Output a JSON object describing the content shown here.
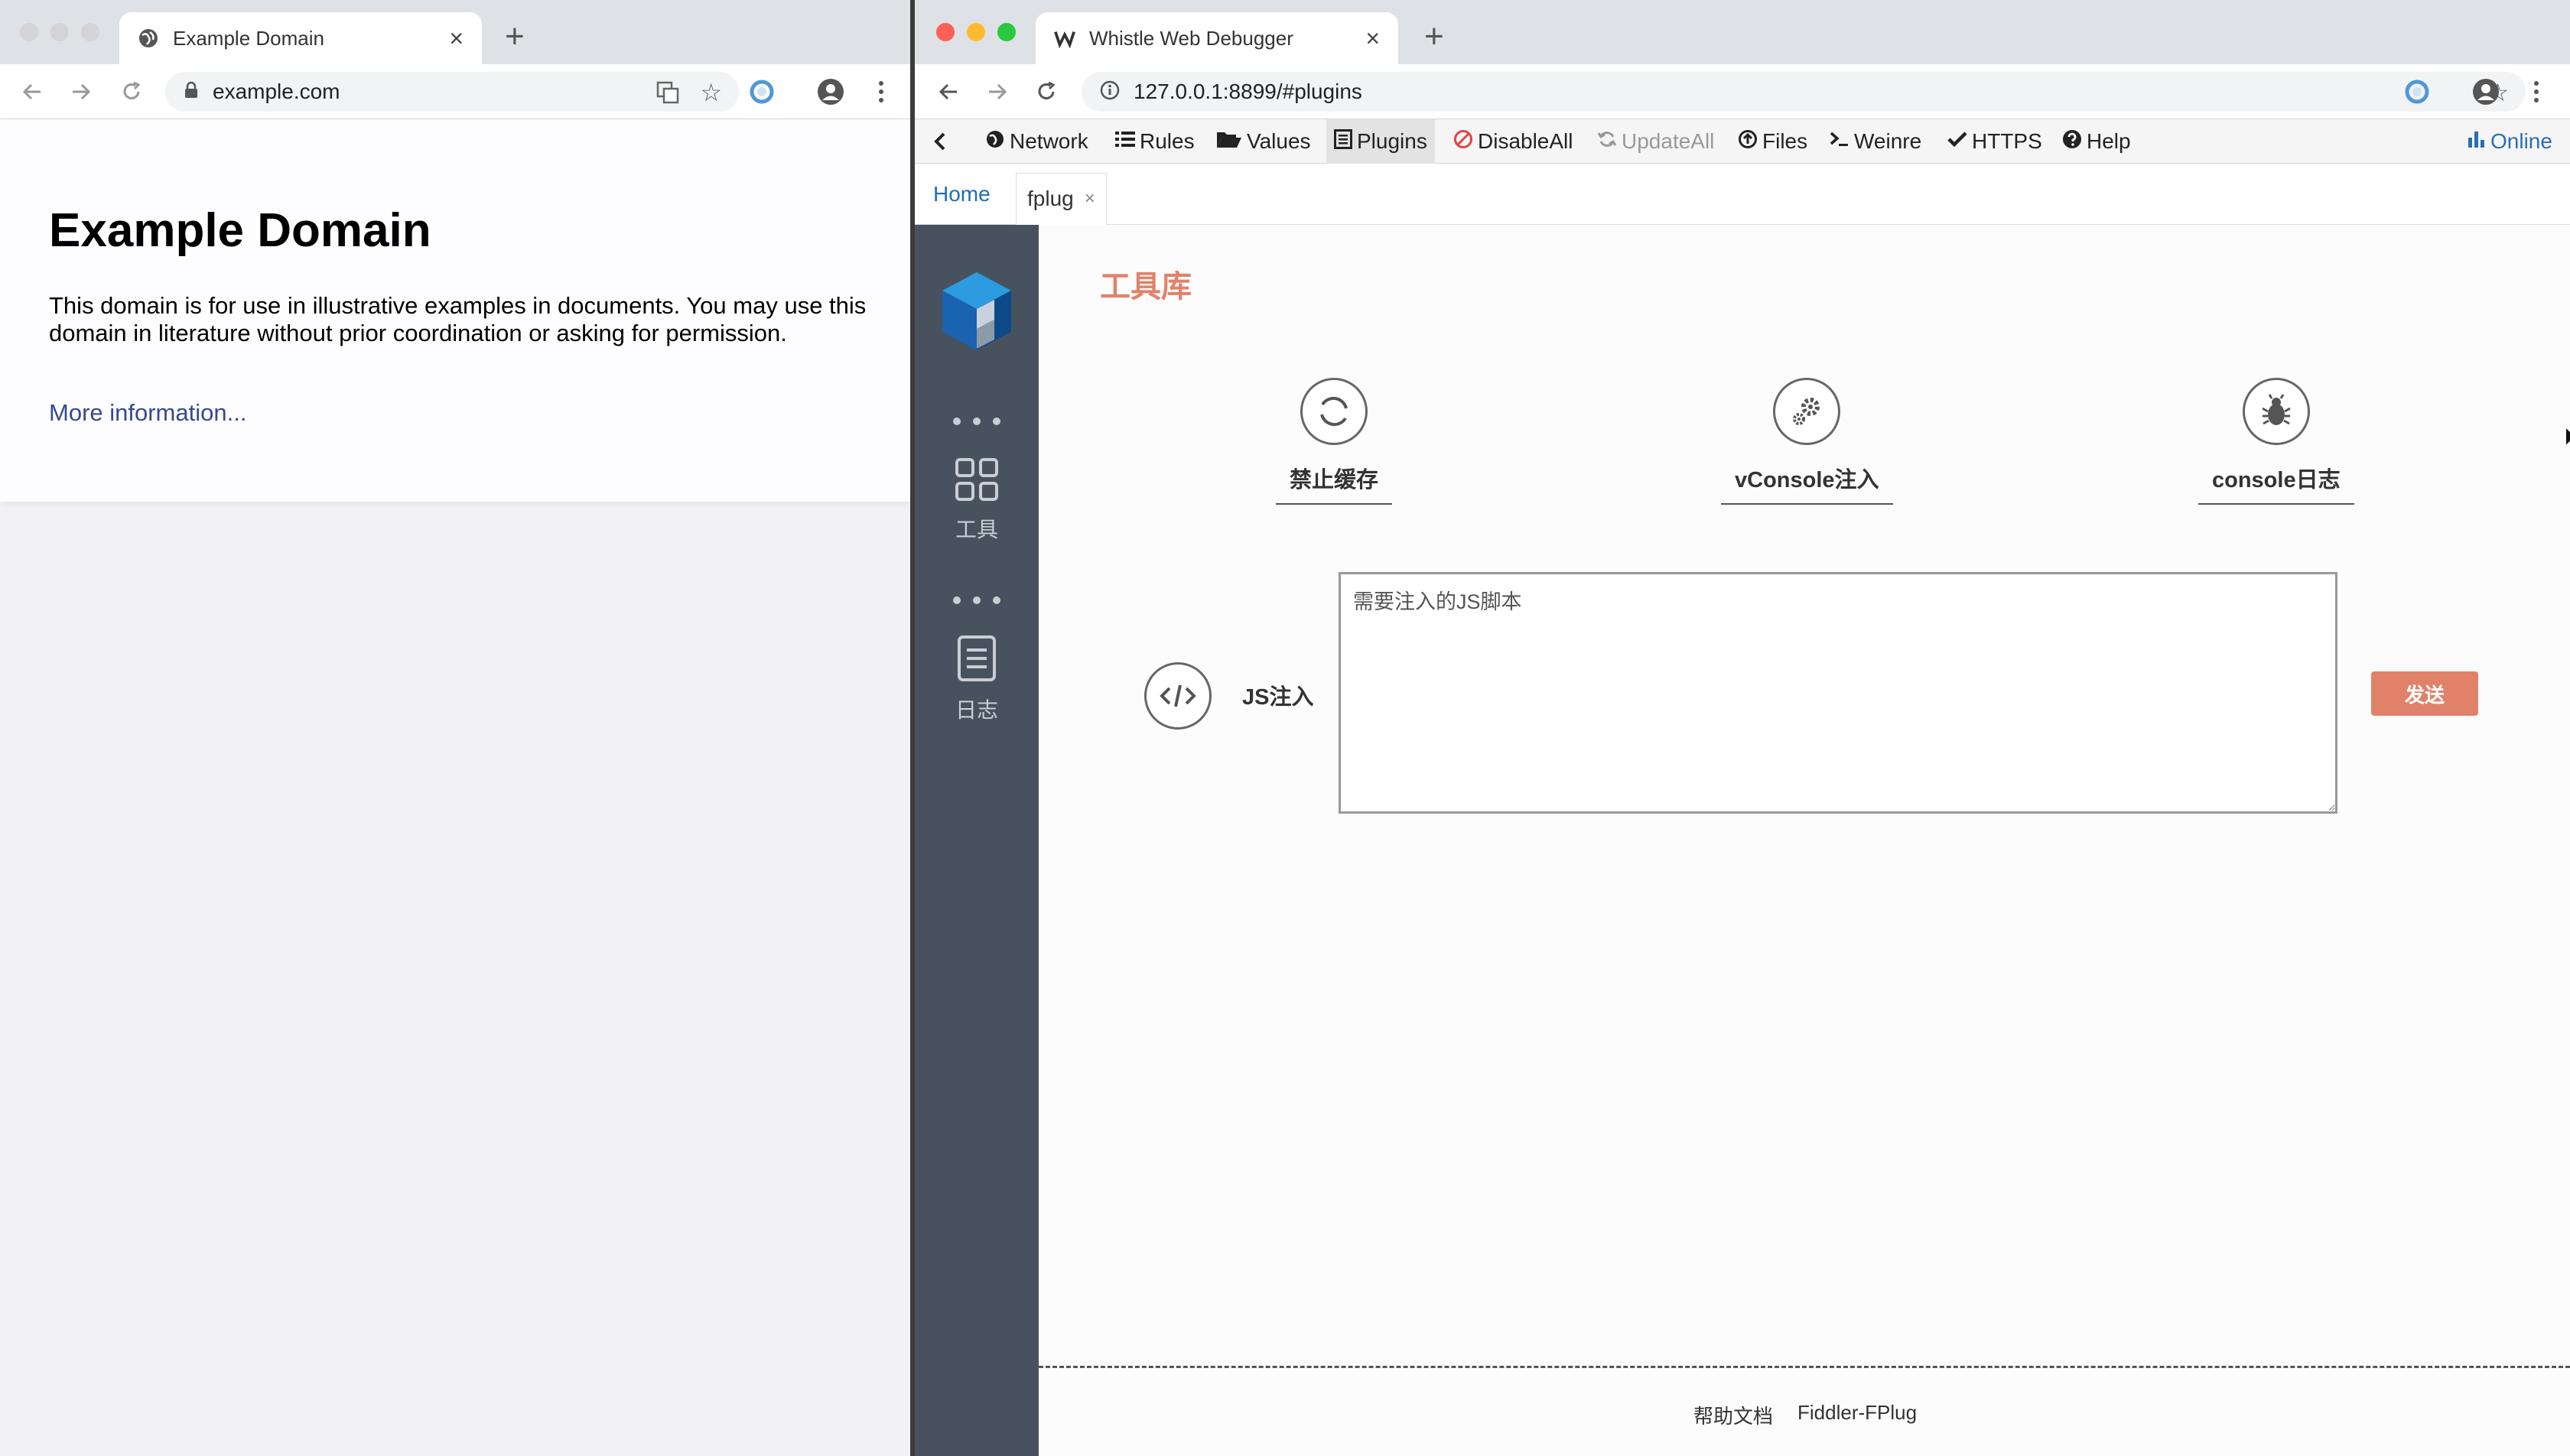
{
  "left_window": {
    "tab": {
      "title": "Example Domain",
      "close": "×"
    },
    "new_tab": "+",
    "address": "example.com",
    "page": {
      "heading": "Example Domain",
      "paragraph": "This domain is for use in illustrative examples in documents. You may use this domain in literature without prior coordination or asking for permission.",
      "link": "More information..."
    }
  },
  "right_window": {
    "tab": {
      "title": "Whistle Web Debugger",
      "close": "×"
    },
    "new_tab": "+",
    "address": "127.0.0.1:8899/#plugins",
    "menu": {
      "network": "Network",
      "rules": "Rules",
      "values": "Values",
      "plugins": "Plugins",
      "disable_all": "DisableAll",
      "update_all": "UpdateAll",
      "files": "Files",
      "weinre": "Weinre",
      "https": "HTTPS",
      "help": "Help",
      "online": "Online"
    },
    "tabs": {
      "home": "Home",
      "fplug": "fplug",
      "fplug_close": "×"
    },
    "sidebar": {
      "tools_label": "工具",
      "logs_label": "日志"
    },
    "content": {
      "title": "工具库",
      "tools": [
        {
          "label": "禁止缓存",
          "icon": "refresh-icon"
        },
        {
          "label": "vConsole注入",
          "icon": "gears-icon"
        },
        {
          "label": "console日志",
          "icon": "bug-icon"
        }
      ],
      "js_inject": {
        "label": "JS注入",
        "placeholder": "需要注入的JS脚本",
        "send": "发送"
      },
      "footer": {
        "docs": "帮助文档",
        "brand": "Fiddler-FPlug"
      }
    }
  },
  "colors": {
    "accent": "#e0826a",
    "sidebar": "#48525e",
    "link": "#1f6db3"
  }
}
